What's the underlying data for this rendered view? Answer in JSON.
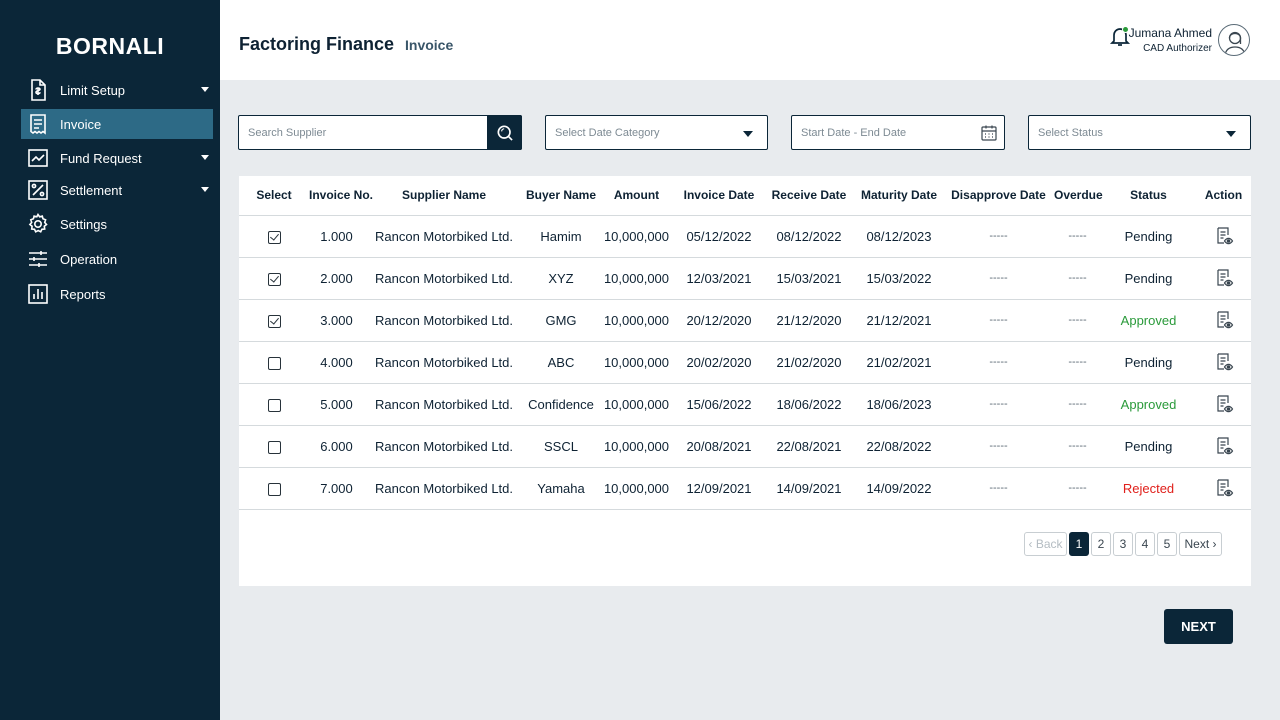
{
  "sidebar": {
    "brand": "BORNALI",
    "items": [
      {
        "label": "Limit Setup",
        "icon": "document-icon",
        "has_caret": true
      },
      {
        "label": "Invoice",
        "icon": "receipt-icon",
        "has_caret": false,
        "active": true
      },
      {
        "label": "Fund Request",
        "icon": "trend-chart-icon",
        "has_caret": true
      },
      {
        "label": "Settlement",
        "icon": "percent-icon",
        "has_caret": true
      },
      {
        "label": "Settings",
        "icon": "gear-icon",
        "has_caret": false
      },
      {
        "label": "Operation",
        "icon": "sliders-icon",
        "has_caret": false
      },
      {
        "label": "Reports",
        "icon": "bar-chart-icon",
        "has_caret": false
      }
    ]
  },
  "header": {
    "title": "Factoring Finance",
    "crumb": "Invoice",
    "user_name": "Jumana Ahmed",
    "user_role": "CAD Authorizer"
  },
  "filters": {
    "search_placeholder": "Search Supplier",
    "date_category_placeholder": "Select Date Category",
    "date_range_placeholder": "Start Date - End Date",
    "status_placeholder": "Select Status"
  },
  "table": {
    "columns": [
      "Select",
      "Invoice No.",
      "Supplier Name",
      "Buyer Name",
      "Amount",
      "Invoice Date",
      "Receive Date",
      "Maturity Date",
      "Disapprove Date",
      "Overdue",
      "Status",
      "Action"
    ],
    "rows": [
      {
        "selected": true,
        "invoice_no": "1.000",
        "supplier": "Rancon Motorbiked Ltd.",
        "buyer": "Hamim",
        "amount": "10,000,000",
        "invoice_date": "05/12/2022",
        "receive_date": "08/12/2022",
        "maturity_date": "08/12/2023",
        "disapprove_date": "-----",
        "overdue": "-----",
        "status": "Pending"
      },
      {
        "selected": true,
        "invoice_no": "2.000",
        "supplier": "Rancon Motorbiked Ltd.",
        "buyer": "XYZ",
        "amount": "10,000,000",
        "invoice_date": "12/03/2021",
        "receive_date": "15/03/2021",
        "maturity_date": "15/03/2022",
        "disapprove_date": "-----",
        "overdue": "-----",
        "status": "Pending"
      },
      {
        "selected": true,
        "invoice_no": "3.000",
        "supplier": "Rancon Motorbiked Ltd.",
        "buyer": "GMG",
        "amount": "10,000,000",
        "invoice_date": "20/12/2020",
        "receive_date": "21/12/2020",
        "maturity_date": "21/12/2021",
        "disapprove_date": "-----",
        "overdue": "-----",
        "status": "Approved"
      },
      {
        "selected": false,
        "invoice_no": "4.000",
        "supplier": "Rancon Motorbiked Ltd.",
        "buyer": "ABC",
        "amount": "10,000,000",
        "invoice_date": "20/02/2020",
        "receive_date": "21/02/2020",
        "maturity_date": "21/02/2021",
        "disapprove_date": "-----",
        "overdue": "-----",
        "status": "Pending"
      },
      {
        "selected": false,
        "invoice_no": "5.000",
        "supplier": "Rancon Motorbiked Ltd.",
        "buyer": "Confidence",
        "amount": "10,000,000",
        "invoice_date": "15/06/2022",
        "receive_date": "18/06/2022",
        "maturity_date": "18/06/2023",
        "disapprove_date": "-----",
        "overdue": "-----",
        "status": "Approved"
      },
      {
        "selected": false,
        "invoice_no": "6.000",
        "supplier": "Rancon Motorbiked Ltd.",
        "buyer": "SSCL",
        "amount": "10,000,000",
        "invoice_date": "20/08/2021",
        "receive_date": "22/08/2021",
        "maturity_date": "22/08/2022",
        "disapprove_date": "-----",
        "overdue": "-----",
        "status": "Pending"
      },
      {
        "selected": false,
        "invoice_no": "7.000",
        "supplier": "Rancon Motorbiked Ltd.",
        "buyer": "Yamaha",
        "amount": "10,000,000",
        "invoice_date": "12/09/2021",
        "receive_date": "14/09/2021",
        "maturity_date": "14/09/2022",
        "disapprove_date": "-----",
        "overdue": "-----",
        "status": "Rejected"
      }
    ]
  },
  "pagination": {
    "back_label": "‹ Back",
    "pages": [
      "1",
      "2",
      "3",
      "4",
      "5"
    ],
    "current_page": "1",
    "next_label": "Next ›"
  },
  "footer": {
    "next_button": "NEXT"
  },
  "colors": {
    "sidebar_bg": "#0b2638",
    "active_item": "#2d6a86",
    "approved": "#2a9a3a",
    "rejected": "#e0201b"
  }
}
